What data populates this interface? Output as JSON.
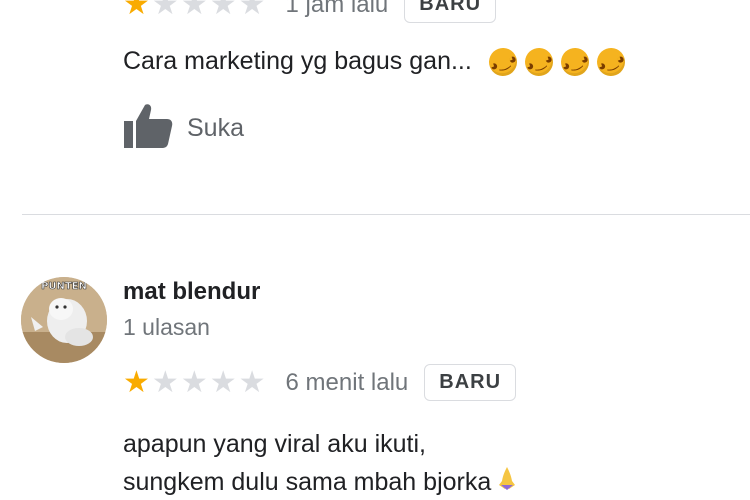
{
  "review_1": {
    "rating": 1,
    "rating_max": 5,
    "time": "1 jam lalu",
    "badge": "BARU",
    "text": "Cara marketing yg bagus gan...",
    "emojis": [
      "rolling-on-floor-laughing",
      "rolling-on-floor-laughing",
      "rolling-on-floor-laughing",
      "rolling-on-floor-laughing"
    ],
    "like_label": "Suka"
  },
  "review_2": {
    "reviewer_name": "mat blendur",
    "reviewer_meta": "1 ulasan",
    "avatar_text": "PUNTEN",
    "rating": 1,
    "rating_max": 5,
    "time": "6 menit lalu",
    "badge": "BARU",
    "text_line_1": "apapun yang viral aku ikuti,",
    "text_line_2": "sungkem dulu sama mbah bjorka",
    "text_emoji": "folded-hands"
  },
  "colors": {
    "star_filled": "#f9ab00",
    "star_empty": "#dadce0",
    "muted_text": "#70757a",
    "divider": "#dadce0"
  }
}
